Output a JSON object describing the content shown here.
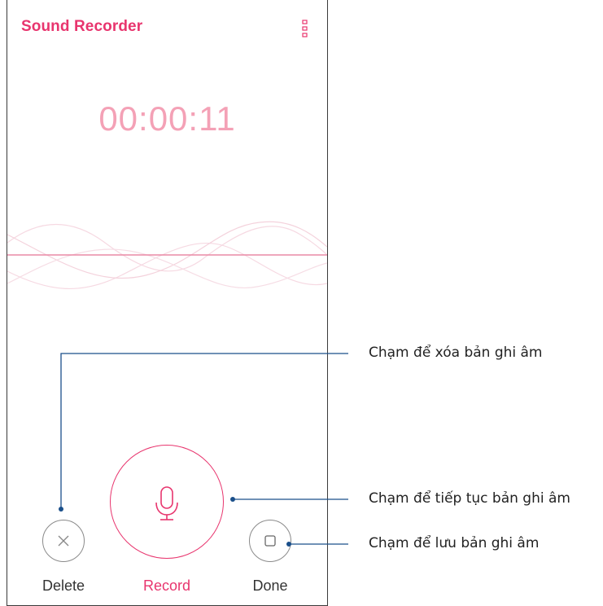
{
  "header": {
    "title": "Sound Recorder",
    "menu_icon": "overflow-menu-icon"
  },
  "timer": {
    "elapsed": "00:00:11"
  },
  "colors": {
    "accent": "#e8356e",
    "timer": "#f4a1b6",
    "callout_line": "#1a4f8a"
  },
  "controls": {
    "delete": {
      "label": "Delete",
      "icon": "close-icon"
    },
    "record": {
      "label": "Record",
      "icon": "microphone-icon"
    },
    "done": {
      "label": "Done",
      "icon": "stop-icon"
    }
  },
  "callouts": {
    "delete": "Chạm để xóa bản ghi âm",
    "record": "Chạm để tiếp tục bản ghi âm",
    "done": "Chạm để lưu bản ghi âm"
  }
}
